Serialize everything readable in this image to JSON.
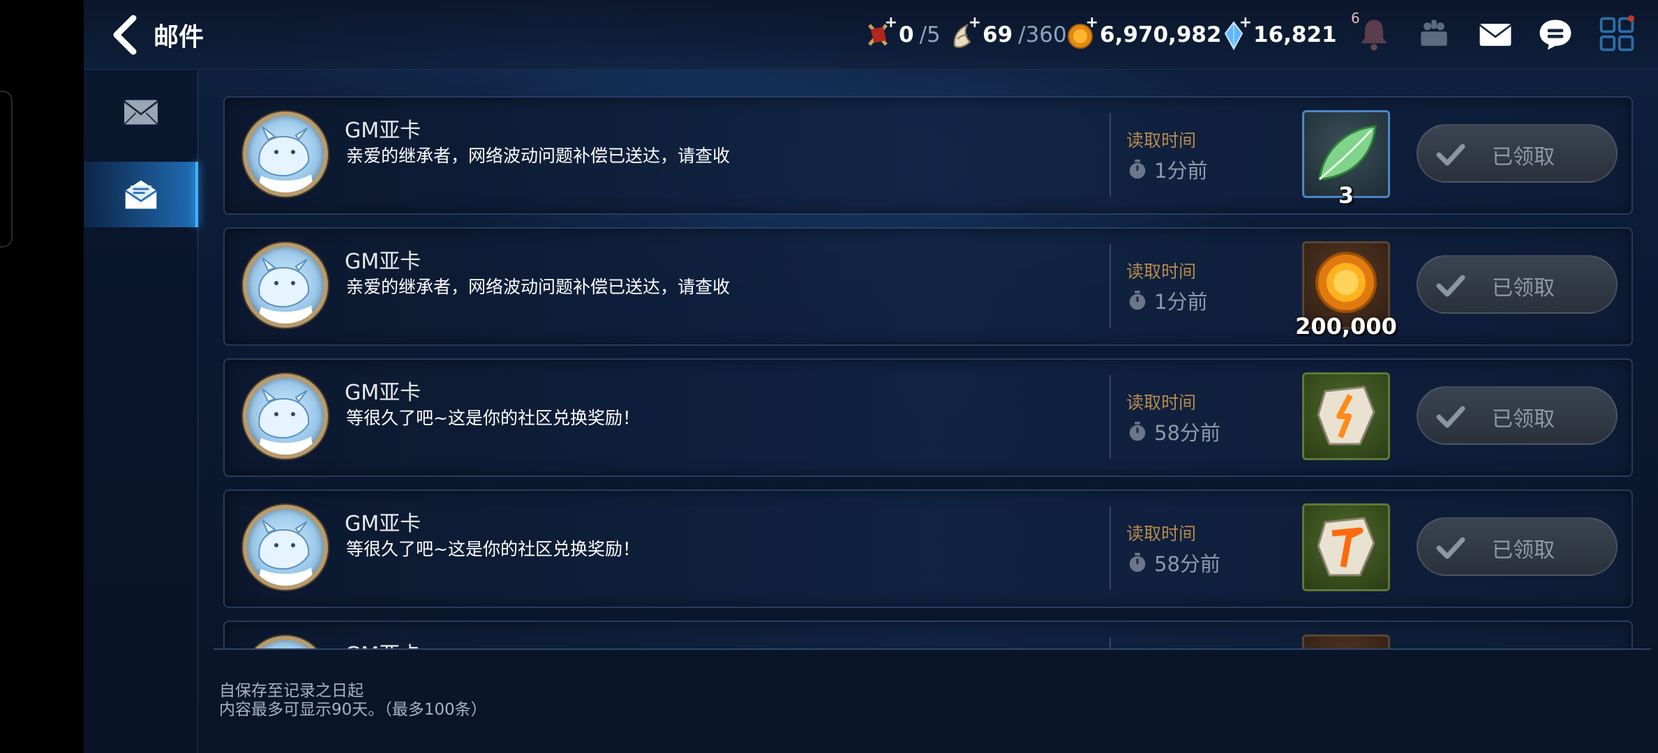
{
  "header": {
    "title": "邮件"
  },
  "resources": [
    {
      "name": "stamina",
      "value": "0",
      "max": "/5",
      "icon": "sword-flag-icon"
    },
    {
      "name": "energy",
      "value": "69",
      "max": "/360",
      "icon": "horn-icon"
    },
    {
      "name": "gold",
      "value": "6,970,982",
      "icon": "gold-coin-icon"
    },
    {
      "name": "crystal",
      "value": "16,821",
      "icon": "blue-crystal-icon"
    }
  ],
  "top_icons": {
    "bell_badge": "6"
  },
  "sidebar": {
    "tabs": [
      {
        "name": "inbox",
        "icon": "envelope-icon",
        "active": false
      },
      {
        "name": "opened",
        "icon": "open-envelope-icon",
        "active": true
      }
    ]
  },
  "mails": [
    {
      "sender": "GM亚卡",
      "message": "亲爱的继承者，网络波动问题补偿已送达，请查收",
      "read_label": "读取时间",
      "read_time": "1分前",
      "item": "leaf",
      "item_count": "3",
      "claim_label": "已领取"
    },
    {
      "sender": "GM亚卡",
      "message": "亲爱的继承者，网络波动问题补偿已送达，请查收",
      "read_label": "读取时间",
      "read_time": "1分前",
      "item": "gold-coin",
      "item_count": "200,000",
      "claim_label": "已领取"
    },
    {
      "sender": "GM亚卡",
      "message": "等很久了吧~这是你的社区兑换奖励！",
      "read_label": "读取时间",
      "read_time": "58分前",
      "item": "rune-stone-yellow",
      "item_count": "",
      "claim_label": "已领取"
    },
    {
      "sender": "GM亚卡",
      "message": "等很久了吧~这是你的社区兑换奖励！",
      "read_label": "读取时间",
      "read_time": "58分前",
      "item": "rune-stone-orange",
      "item_count": "",
      "claim_label": "已领取"
    },
    {
      "sender": "GM亚卡",
      "message": "",
      "read_label": "",
      "read_time": "",
      "item": "item-partial",
      "item_count": "",
      "claim_label": ""
    }
  ],
  "footer": {
    "line1": "自保存至记录之日起",
    "line2": "内容最多可显示90天。（最多100条）"
  },
  "colors": {
    "accent": "#3fb4ff",
    "read_label": "#b58a4b",
    "claimed_text": "#9099a6"
  }
}
